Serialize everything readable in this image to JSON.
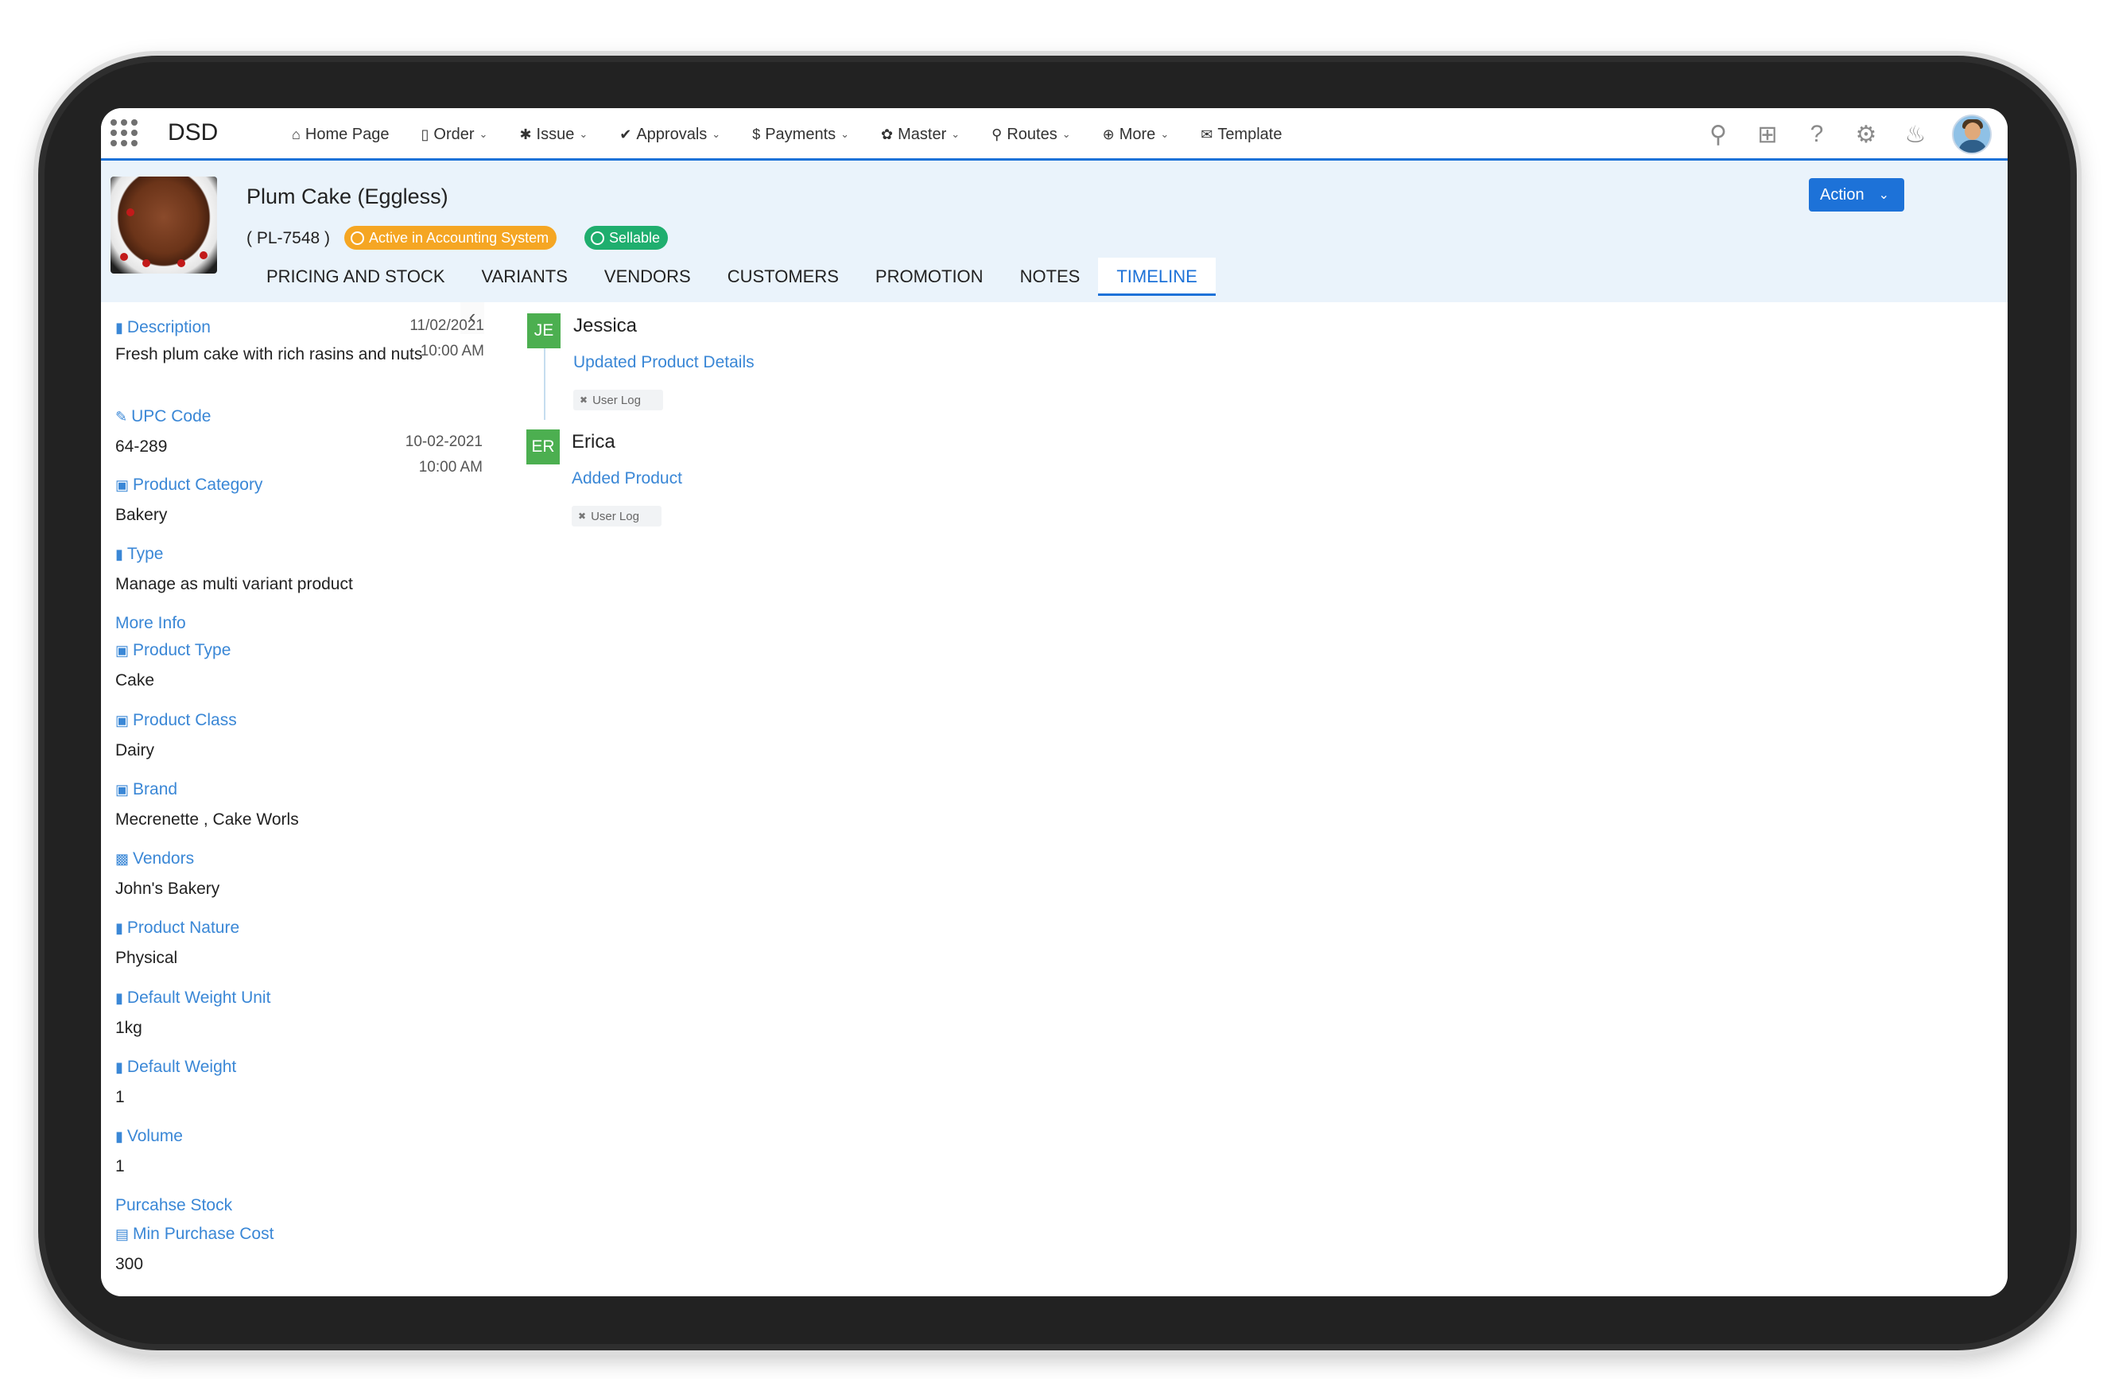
{
  "app": {
    "brand": "DSD"
  },
  "nav": {
    "items": [
      {
        "icon": "home-icon",
        "glyph": "⌂",
        "label": "Home Page",
        "caret": false
      },
      {
        "icon": "document-icon",
        "glyph": "▯",
        "label": "Order",
        "caret": true
      },
      {
        "icon": "bug-icon",
        "glyph": "✱",
        "label": "Issue",
        "caret": true
      },
      {
        "icon": "check-icon",
        "glyph": "✔",
        "label": "Approvals",
        "caret": true
      },
      {
        "icon": "dollar-icon",
        "glyph": "$",
        "label": "Payments",
        "caret": true
      },
      {
        "icon": "gear-icon",
        "glyph": "✿",
        "label": "Master",
        "caret": true
      },
      {
        "icon": "map-pin-icon",
        "glyph": "⚲",
        "label": "Routes",
        "caret": true
      },
      {
        "icon": "plus-circle-icon",
        "glyph": "⊕",
        "label": "More",
        "caret": true
      },
      {
        "icon": "envelope-icon",
        "glyph": "✉",
        "label": "Template",
        "caret": false
      }
    ]
  },
  "product": {
    "title": "Plum Cake (Eggless)",
    "code": "( PL-7548 )",
    "badges": {
      "accounting": "Active in Accounting System",
      "sellable": "Sellable"
    },
    "action_label": "Action"
  },
  "tabs": [
    "PRICING AND STOCK",
    "VARIANTS",
    "VENDORS",
    "CUSTOMERS",
    "PROMOTION",
    "NOTES",
    "TIMELINE"
  ],
  "active_tab": "TIMELINE",
  "sidebar": {
    "description": {
      "label": "Description",
      "value": "Fresh plum cake with rich rasins and nuts"
    },
    "upc": {
      "label": "UPC Code",
      "value": "64-289"
    },
    "category": {
      "label": "Product Category",
      "value": "Bakery"
    },
    "type": {
      "label": "Type",
      "value": "Manage as multi variant product"
    },
    "more_info": "More Info",
    "product_type": {
      "label": "Product Type",
      "value": "Cake"
    },
    "product_class": {
      "label": "Product Class",
      "value": "Dairy"
    },
    "brand": {
      "label": "Brand",
      "value": "Mecrenette , Cake Worls"
    },
    "vendors": {
      "label": "Vendors",
      "value": "John's Bakery"
    },
    "nature": {
      "label": "Product Nature",
      "value": "Physical"
    },
    "weight_unit": {
      "label": "Default Weight Unit",
      "value": "1kg"
    },
    "weight": {
      "label": "Default Weight",
      "value": "1"
    },
    "volume": {
      "label": "Volume",
      "value": "1"
    },
    "purchase_stock": "Purcahse Stock",
    "min_cost": {
      "label": "Min Purchase Cost",
      "value": "300"
    }
  },
  "timeline": [
    {
      "date": "11/02/2021",
      "time": "10:00 AM",
      "initials": "JE",
      "name": "Jessica",
      "action": "Updated Product Details",
      "tag": "User Log"
    },
    {
      "date": "10-02-2021",
      "time": "10:00 AM",
      "initials": "ER",
      "name": "Erica",
      "action": "Added Product",
      "tag": "User Log"
    }
  ],
  "colors": {
    "accent": "#1d72d8",
    "link": "#3a87d6",
    "badge_orange": "#f5a623",
    "badge_green": "#1fae6e",
    "avatar_green": "#4caf50"
  }
}
